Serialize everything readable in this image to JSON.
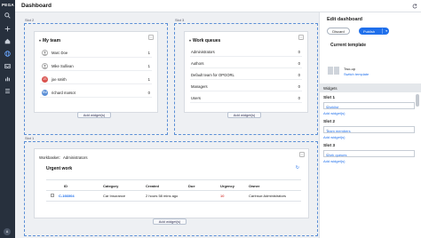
{
  "app": {
    "brand": "PEGA",
    "avatar_initials": "A",
    "page_title": "Dashboard"
  },
  "rail_icons": [
    "search-icon",
    "plus-icon",
    "home-icon",
    "globe-icon",
    "inbox-icon",
    "chart-icon",
    "bulk-icon"
  ],
  "slots": {
    "slot2": "Slot 2",
    "slot3": "Slot 3",
    "slot1": "Slot 1"
  },
  "my_team": {
    "title": "My team",
    "members": [
      {
        "initials": "",
        "name": "Marc Doe",
        "count": "1",
        "color": "#ffffff"
      },
      {
        "initials": "",
        "name": "Mike Sullivan",
        "count": "1",
        "color": "#ffffff"
      },
      {
        "initials": "JS",
        "name": "joe smith",
        "count": "1",
        "color": "#d9534f"
      },
      {
        "initials": "RM",
        "name": "richard marsot",
        "count": "0",
        "color": "#5b8fd6"
      }
    ],
    "add": "Add widget(s)"
  },
  "work_queues": {
    "title": "Work queues",
    "queues": [
      {
        "name": "Administrators",
        "count": "0"
      },
      {
        "name": "Authors",
        "count": "0"
      },
      {
        "name": "Default team for OPGORL",
        "count": "0"
      },
      {
        "name": "Managers",
        "count": "0"
      },
      {
        "name": "Users",
        "count": "0"
      }
    ],
    "add": "Add widget(s)"
  },
  "workbasket": {
    "label": "Workbasket:",
    "value": "Administrators",
    "title": "Urgent work",
    "columns": [
      "ID",
      "Category",
      "Created",
      "Due",
      "Urgency",
      "Owner"
    ],
    "rows": [
      {
        "id": "C-166004",
        "category": "Car Insurance",
        "created": "2 hours 58 mins ago",
        "due": "",
        "urgency": "10",
        "owner": "CarInsur:Administrators"
      }
    ],
    "add": "Add widget(s)"
  },
  "panel": {
    "title": "Edit dashboard",
    "discard": "Discard",
    "publish": "Publish",
    "current_template": "Current template",
    "template_name": "Two-up",
    "switch_template": "Switch template",
    "widgets_header": "Widgets",
    "slots": [
      {
        "label": "Slot 1",
        "item": "Worklist",
        "add": "Add widget(s)"
      },
      {
        "label": "Slot 2",
        "item": "Team members",
        "add": "Add widget(s)"
      },
      {
        "label": "Slot 3",
        "item": "Work queues",
        "add": "Add widget(s)"
      }
    ]
  },
  "colors": {
    "accent": "#1f6feb",
    "rail": "#27303d",
    "urgency": "#d9534f",
    "slot_border": "#5b8fd6"
  }
}
